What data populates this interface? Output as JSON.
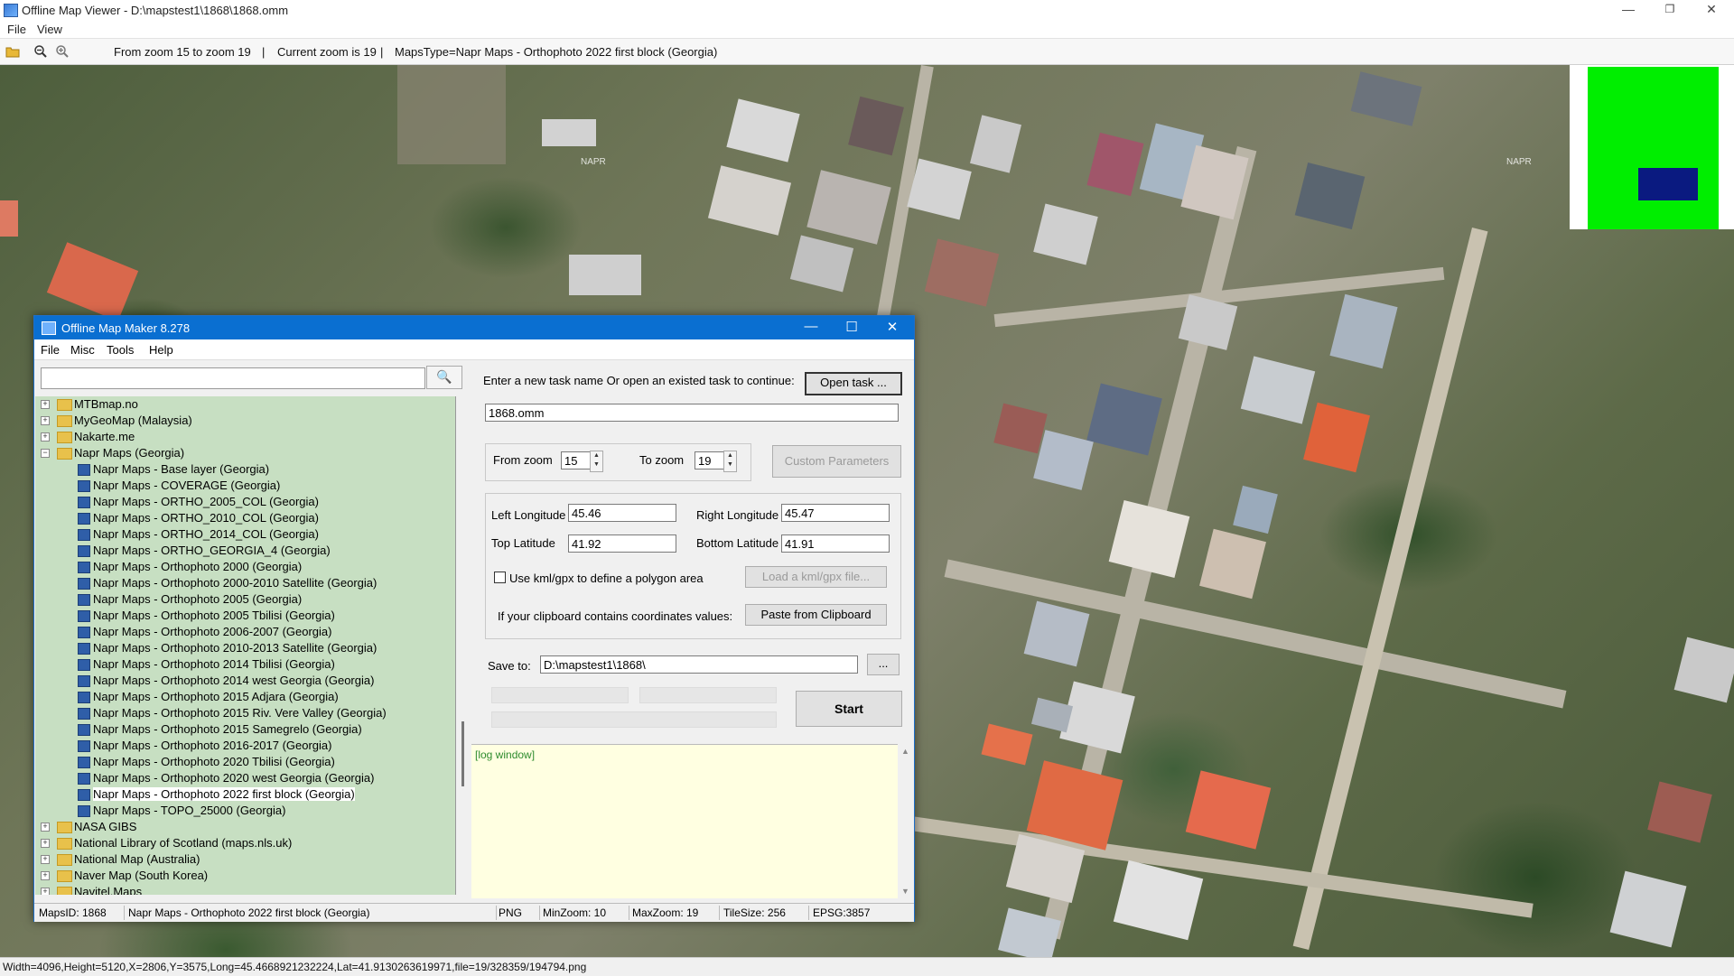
{
  "window": {
    "title": "Offline Map Viewer - D:\\mapstest1\\1868\\1868.omm",
    "controls": {
      "minimize": "—",
      "maximize": "❐",
      "close": "✕"
    }
  },
  "menubar": [
    "File",
    "View"
  ],
  "toolbar": {
    "zoom_range": "From zoom 15 to zoom 19",
    "separator": "|",
    "current_zoom": "Current zoom is 19",
    "separator2": "|",
    "maps_type": "MapsType=Napr Maps - Orthophoto 2022 first block (Georgia)"
  },
  "map": {
    "watermarks": [
      "NAPR",
      "NAPR"
    ]
  },
  "status_bar": "Width=4096,Height=5120,X=2806,Y=3575,Long=45.4668921232224,Lat=41.9130263619971,file=19/328359/194794.png",
  "dialog": {
    "title": "Offline Map Maker 8.278",
    "controls": {
      "minimize": "—",
      "maximize": "☐",
      "close": "✕"
    },
    "menu": [
      "File",
      "Misc",
      "Tools",
      "Help"
    ],
    "search": {
      "value": "",
      "button_icon": "🔍"
    },
    "tree": {
      "items": [
        {
          "type": "folder",
          "expand": "+",
          "label": "MTBmap.no"
        },
        {
          "type": "folder",
          "expand": "+",
          "label": "MyGeoMap (Malaysia)"
        },
        {
          "type": "folder",
          "expand": "+",
          "label": "Nakarte.me"
        },
        {
          "type": "folder-open",
          "expand": "−",
          "label": "Napr Maps (Georgia)"
        },
        {
          "type": "map",
          "label": "Napr Maps - Base layer (Georgia)"
        },
        {
          "type": "map",
          "label": "Napr Maps - COVERAGE (Georgia)"
        },
        {
          "type": "map",
          "label": "Napr Maps - ORTHO_2005_COL (Georgia)"
        },
        {
          "type": "map",
          "label": "Napr Maps - ORTHO_2010_COL (Georgia)"
        },
        {
          "type": "map",
          "label": "Napr Maps - ORTHO_2014_COL (Georgia)"
        },
        {
          "type": "map",
          "label": "Napr Maps - ORTHO_GEORGIA_4 (Georgia)"
        },
        {
          "type": "map",
          "label": "Napr Maps - Orthophoto 2000 (Georgia)"
        },
        {
          "type": "map",
          "label": "Napr Maps - Orthophoto 2000-2010 Satellite (Georgia)"
        },
        {
          "type": "map",
          "label": "Napr Maps - Orthophoto 2005 (Georgia)"
        },
        {
          "type": "map",
          "label": "Napr Maps - Orthophoto 2005 Tbilisi (Georgia)"
        },
        {
          "type": "map",
          "label": "Napr Maps - Orthophoto 2006-2007 (Georgia)"
        },
        {
          "type": "map",
          "label": "Napr Maps - Orthophoto 2010-2013 Satellite (Georgia)"
        },
        {
          "type": "map",
          "label": "Napr Maps - Orthophoto 2014 Tbilisi (Georgia)"
        },
        {
          "type": "map",
          "label": "Napr Maps - Orthophoto 2014 west Georgia (Georgia)"
        },
        {
          "type": "map",
          "label": "Napr Maps - Orthophoto 2015 Adjara (Georgia)"
        },
        {
          "type": "map",
          "label": "Napr Maps - Orthophoto 2015 Riv. Vere Valley (Georgia)"
        },
        {
          "type": "map",
          "label": "Napr Maps - Orthophoto 2015 Samegrelo (Georgia)"
        },
        {
          "type": "map",
          "label": "Napr Maps - Orthophoto 2016-2017 (Georgia)"
        },
        {
          "type": "map",
          "label": "Napr Maps - Orthophoto 2020 Tbilisi (Georgia)"
        },
        {
          "type": "map",
          "label": "Napr Maps - Orthophoto 2020 west Georgia (Georgia)"
        },
        {
          "type": "map",
          "label": "Napr Maps - Orthophoto 2022 first block (Georgia)",
          "selected": true
        },
        {
          "type": "map",
          "label": "Napr Maps - TOPO_25000 (Georgia)"
        },
        {
          "type": "folder",
          "expand": "+",
          "label": "NASA GIBS"
        },
        {
          "type": "folder",
          "expand": "+",
          "label": "National Library of Scotland (maps.nls.uk)"
        },
        {
          "type": "folder",
          "expand": "+",
          "label": "National Map (Australia)"
        },
        {
          "type": "folder",
          "expand": "+",
          "label": "Naver Map (South Korea)"
        },
        {
          "type": "folder",
          "expand": "+",
          "label": "Navitel.Maps"
        }
      ]
    },
    "task": {
      "prompt": "Enter a new task name Or open an existed task to continue:",
      "open_button": "Open task ...",
      "name_value": "1868.omm"
    },
    "zoom": {
      "from_label": "From zoom",
      "from_value": "15",
      "to_label": "To zoom",
      "to_value": "19",
      "custom_button": "Custom Parameters"
    },
    "coords": {
      "left_lon_label": "Left Longitude",
      "left_lon_value": "45.46",
      "right_lon_label": "Right Longitude",
      "right_lon_value": "45.47",
      "top_lat_label": "Top Latitude",
      "top_lat_value": "41.92",
      "bottom_lat_label": "Bottom Latitude",
      "bottom_lat_value": "41.91",
      "kml_checkbox_label": "Use kml/gpx to define a polygon area",
      "kml_button": "Load a kml/gpx file...",
      "clipboard_label": "If your clipboard contains coordinates values:",
      "clipboard_button": "Paste from Clipboard"
    },
    "save": {
      "label": "Save to:",
      "value": "D:\\mapstest1\\1868\\",
      "browse": "...",
      "start_button": "Start"
    },
    "log": {
      "text": "[log window]"
    },
    "status": {
      "maps_id": "MapsID: 1868",
      "maps_name": "Napr Maps - Orthophoto 2022 first block (Georgia)",
      "format": "PNG",
      "min_zoom": "MinZoom: 10",
      "max_zoom": "MaxZoom: 19",
      "tile_size": "TileSize: 256",
      "epsg": "EPSG:3857"
    }
  },
  "colors": {
    "tree_background": "#c7dfc2",
    "log_background": "#ffffe1",
    "log_text": "#2e8b2e",
    "dialog_title": "#0a6fd1",
    "minimap_green": "#00ee00",
    "minimap_view": "#0a1a80"
  }
}
